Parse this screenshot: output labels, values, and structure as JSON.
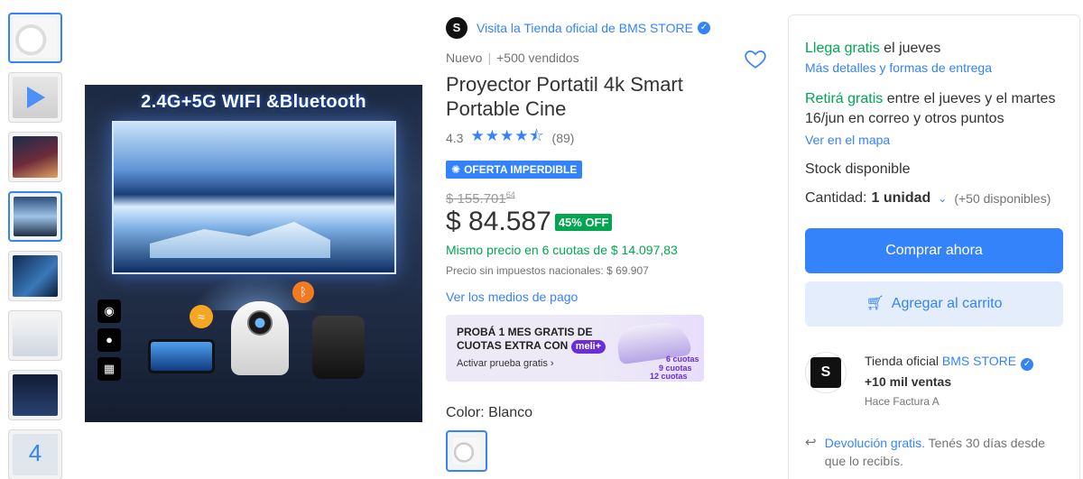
{
  "thumbnails": {
    "more_count": "4"
  },
  "main_image": {
    "banner": "2.4G+5G WIFI &Bluetooth"
  },
  "store": {
    "logo_letter": "S",
    "link_text": "Visita la Tienda oficial de BMS STORE"
  },
  "product": {
    "condition": "Nuevo",
    "sold": "+500 vendidos",
    "title": "Proyector Portatil 4k Smart Portable Cine",
    "rating": "4.3",
    "stars": "★★★★⯪",
    "reviews": "(89)",
    "deal_label": "OFERTA IMPERDIBLE",
    "old_price": "$ 155.701",
    "old_price_cents": "64",
    "price": "$ 84.587",
    "discount": "45% OFF",
    "installments": "Mismo precio en 6 cuotas de $ 14.097,83",
    "no_tax": "Precio sin impuestos nacionales: $ 69.907",
    "payment_link": "Ver los medios de pago",
    "color_label": "Color:",
    "color_value": "Blanco"
  },
  "promo": {
    "line1": "PROBÁ 1 MES GRATIS DE",
    "line2": "CUOTAS EXTRA CON",
    "brand": "meli+",
    "cta": "Activar prueba gratis ›",
    "tag1": "6 cuotas",
    "tag2": "9 cuotas",
    "tag3": "12 cuotas"
  },
  "panel": {
    "ship_highlight": "Llega gratis",
    "ship_rest": " el jueves",
    "ship_link": "Más detalles y formas de entrega",
    "pickup_highlight": "Retirá gratis",
    "pickup_rest": " entre el jueves y el martes 16/jun en correo y otros puntos",
    "map_link": "Ver en el mapa",
    "stock": "Stock disponible",
    "qty_label": "Cantidad:",
    "qty_value": "1 unidad",
    "qty_available": "(+50 disponibles)",
    "buy_label": "Comprar ahora",
    "cart_label": "Agregar al carrito",
    "seller_prefix": "Tienda oficial",
    "seller_name": "BMS STORE",
    "seller_sales": "+10 mil ventas",
    "seller_invoice": "Hace Factura A",
    "return_link": "Devolución gratis.",
    "return_text": " Tenés 30 días desde que lo recibís."
  },
  "colors": {
    "accent": "#3483fa",
    "green": "#00a650"
  }
}
